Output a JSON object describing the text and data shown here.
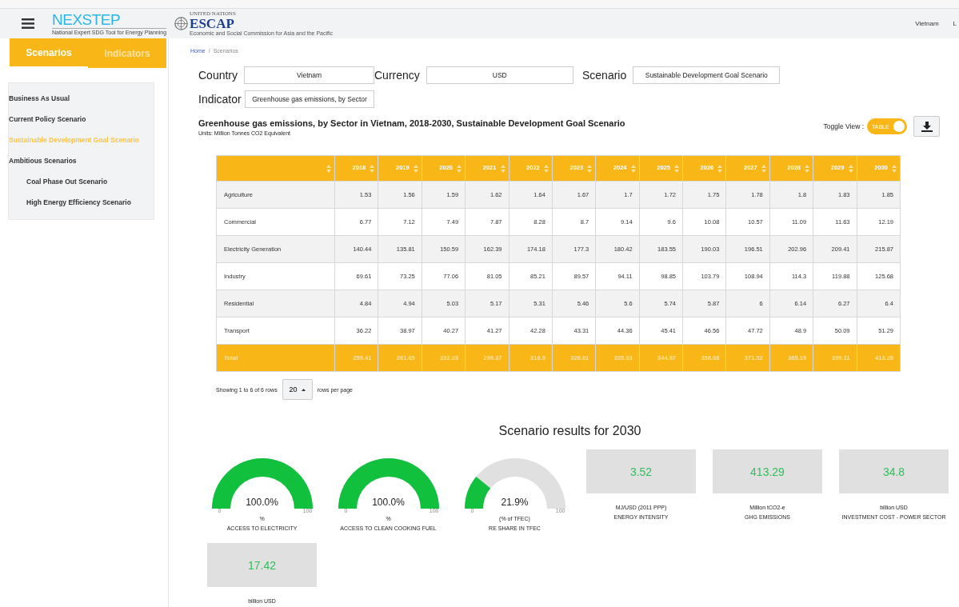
{
  "header": {
    "logo_main": "NEXSTEP",
    "logo_tagline": "National Expert SDG Tool for Energy Planning",
    "logo_partner_top": "UNITED NATIONS",
    "logo_partner": "ESCAP",
    "logo_partner_tagline": "Economic and Social Commission for Asia and the Pacific",
    "right_items": [
      "Vietnam",
      "L"
    ]
  },
  "sidebar": {
    "tabs": [
      {
        "label": "Scenarios",
        "selected": true
      },
      {
        "label": "Indicators",
        "selected": false
      }
    ],
    "items": [
      {
        "label": "Business As Usual",
        "selected": false
      },
      {
        "label": "Current Policy Scenario",
        "selected": false
      },
      {
        "label": "Sustainable Development Goal Scenario",
        "selected": true
      },
      {
        "label": "Ambitious Scenarios",
        "selected": false,
        "children": [
          {
            "label": "Coal Phase Out Scenario",
            "selected": false
          },
          {
            "label": "High Energy Efficiency Scenario",
            "selected": false
          }
        ]
      }
    ]
  },
  "breadcrumb": {
    "separator": "/",
    "items": [
      "Home",
      "Scenarios"
    ]
  },
  "filters": [
    {
      "label": "Country",
      "value": "Vietnam"
    },
    {
      "label": "Currency",
      "value": "USD"
    },
    {
      "label": "Scenario",
      "value": "Sustainable Development Goal Scenario"
    },
    {
      "label": "Indicator",
      "value": "Greenhouse gas emissions, by Sector"
    }
  ],
  "chart_title": "Greenhouse gas emissions, by Sector in Vietnam, 2018-2030, Sustainable Development Goal Scenario",
  "units": "Units: Million Tonnes CO2 Equivalent",
  "toggle": {
    "label": "Toggle View :",
    "text": "TABLE",
    "on": true
  },
  "table": {
    "columns": [
      "2018",
      "2019",
      "2020",
      "2021",
      "2022",
      "2023",
      "2024",
      "2025",
      "2026",
      "2027",
      "2028",
      "2029",
      "2030"
    ],
    "rows": [
      {
        "name": "Agriculture",
        "values": [
          "1.53",
          "1.56",
          "1.59",
          "1.62",
          "1.64",
          "1.67",
          "1.7",
          "1.72",
          "1.75",
          "1.78",
          "1.8",
          "1.83",
          "1.85"
        ]
      },
      {
        "name": "Commercial",
        "values": [
          "6.77",
          "7.12",
          "7.49",
          "7.87",
          "8.28",
          "8.7",
          "9.14",
          "9.6",
          "10.08",
          "10.57",
          "11.09",
          "11.63",
          "12.19"
        ]
      },
      {
        "name": "Electricity Generation",
        "values": [
          "140.44",
          "135.81",
          "150.59",
          "162.39",
          "174.18",
          "177.3",
          "180.42",
          "183.55",
          "190.03",
          "196.51",
          "202.96",
          "209.41",
          "215.87"
        ]
      },
      {
        "name": "Industry",
        "values": [
          "69.61",
          "73.25",
          "77.06",
          "81.05",
          "85.21",
          "89.57",
          "94.11",
          "98.85",
          "103.79",
          "108.94",
          "114.3",
          "119.88",
          "125.68"
        ]
      },
      {
        "name": "Residential",
        "values": [
          "4.84",
          "4.94",
          "5.03",
          "5.17",
          "5.31",
          "5.46",
          "5.6",
          "5.74",
          "5.87",
          "6",
          "6.14",
          "6.27",
          "6.4"
        ]
      },
      {
        "name": "Transport",
        "values": [
          "36.22",
          "38.97",
          "40.27",
          "41.27",
          "42.28",
          "43.31",
          "44.36",
          "45.41",
          "46.56",
          "47.72",
          "48.9",
          "50.09",
          "51.29"
        ]
      }
    ],
    "total": {
      "name": "Total",
      "values": [
        "259.41",
        "261.65",
        "282.03",
        "299.37",
        "316.9",
        "326.01",
        "335.33",
        "344.87",
        "358.08",
        "371.52",
        "385.19",
        "399.11",
        "413.28"
      ]
    }
  },
  "pagination": {
    "showing": "Showing 1 to 6 of 6 rows",
    "page_size": "20",
    "suffix": "rows per page"
  },
  "results": {
    "title": "Scenario results for 2030",
    "items": [
      {
        "kind": "gauge",
        "value": "100.0%",
        "level": 1,
        "min": "0",
        "max": "100",
        "unit": "%",
        "label": "ACCESS TO ELECTRICITY"
      },
      {
        "kind": "gauge",
        "value": "100.0%",
        "level": 1,
        "min": "0",
        "max": "100",
        "unit": "%",
        "label": "ACCESS TO CLEAN COOKING FUEL"
      },
      {
        "kind": "gauge",
        "value": "21.9%",
        "level": 0.219,
        "min": "0",
        "max": "100",
        "unit": "(% of TFEC)",
        "label": "RE SHARE IN TFEC"
      },
      {
        "kind": "number",
        "value": "3.52",
        "unit": "MJ/USD (2011 PPP)",
        "label": "ENERGY INTENSITY"
      },
      {
        "kind": "number",
        "value": "413.29",
        "unit": "Million tCO2-e",
        "label": "GHG EMISSIONS"
      },
      {
        "kind": "number",
        "value": "34.8",
        "unit": "billion USD",
        "label": "INVESTMENT COST - POWER SECTOR"
      },
      {
        "kind": "number",
        "value": "17.42",
        "unit": "billion USD"
      }
    ]
  }
}
